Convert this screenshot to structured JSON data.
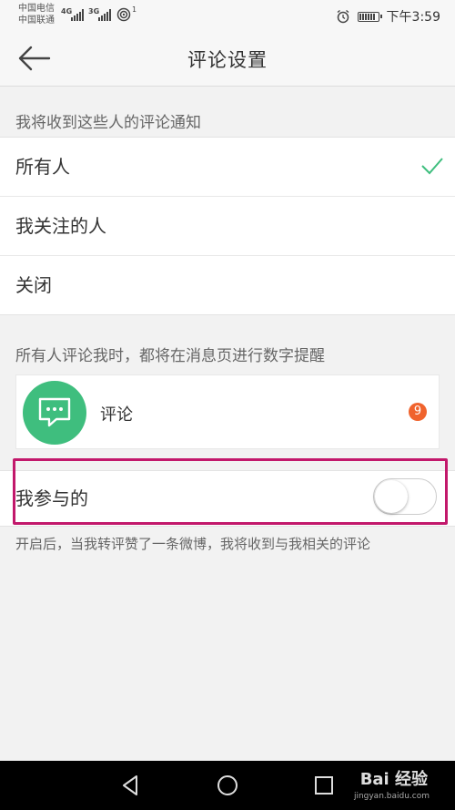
{
  "status_bar": {
    "carrier1": "中国电信",
    "carrier2": "中国联通",
    "net1": "4G",
    "net2": "3G",
    "wifi_count": "1",
    "time": "下午3:59"
  },
  "nav": {
    "title": "评论设置"
  },
  "notify_section": {
    "label": "我将收到这些人的评论通知",
    "options": [
      {
        "label": "所有人",
        "selected": true
      },
      {
        "label": "我关注的人",
        "selected": false
      },
      {
        "label": "关闭",
        "selected": false
      }
    ]
  },
  "preview": {
    "hint": "所有人评论我时，都将在消息页进行数字提醒",
    "label": "评论",
    "badge": "9"
  },
  "participated": {
    "label": "我参与的",
    "enabled": false,
    "footnote": "开启后，当我转评赞了一条微博，我将收到与我相关的评论"
  },
  "watermark": {
    "brand": "Bai 经验",
    "url": "jingyan.baidu.com"
  },
  "colors": {
    "accent": "#3fbe7e",
    "badge": "#f0632d",
    "highlight": "#c2186b"
  }
}
